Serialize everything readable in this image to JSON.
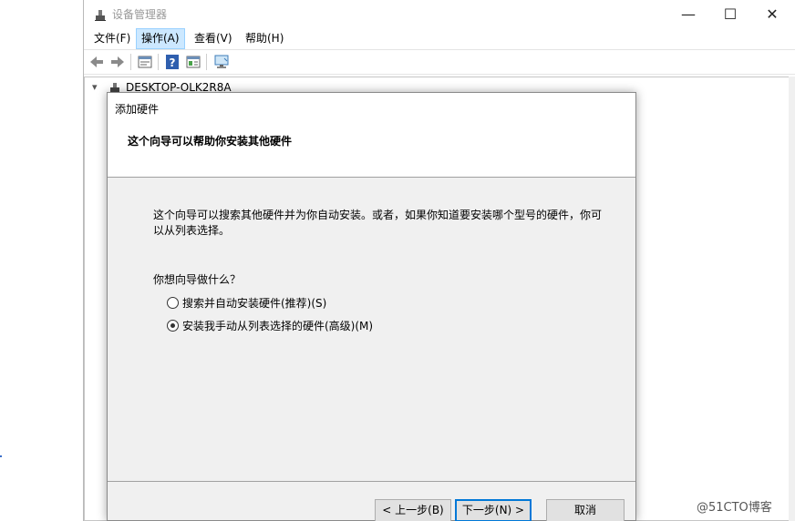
{
  "window": {
    "title": "设备管理器",
    "minimize_glyph": "—",
    "maximize_glyph": "☐",
    "close_glyph": "✕"
  },
  "menu": {
    "items": [
      "文件(F)",
      "操作(A)",
      "查看(V)",
      "帮助(H)"
    ],
    "active": "操作(A)"
  },
  "toolbar": {
    "icons": [
      "back-arrow-icon",
      "forward-arrow-icon",
      "properties-icon",
      "help-icon",
      "action-pane-icon",
      "monitor-icon"
    ]
  },
  "tree": {
    "root_label": "DESKTOP-OLK2R8A",
    "expanded": true
  },
  "wizard": {
    "caption": "添加硬件",
    "heading": "这个向导可以帮助你安装其他硬件",
    "description": "这个向导可以搜索其他硬件并为你自动安装。或者，如果你知道要安装哪个型号的硬件，你可以从列表选择。",
    "question": "你想向导做什么？",
    "options": [
      {
        "label": "搜索并自动安装硬件(推荐)(S)",
        "checked": false
      },
      {
        "label": "安装我手动从列表选择的硬件(高级)(M)",
        "checked": true
      }
    ],
    "buttons": {
      "back": "< 上一步(B)",
      "next": "下一步(N) >",
      "cancel": "取消"
    }
  },
  "watermark": "@51CTO博客",
  "colors": {
    "menu_highlight": "#cce8ff",
    "default_button_border": "#0078d7",
    "dialog_bg": "#f0f0f0"
  }
}
